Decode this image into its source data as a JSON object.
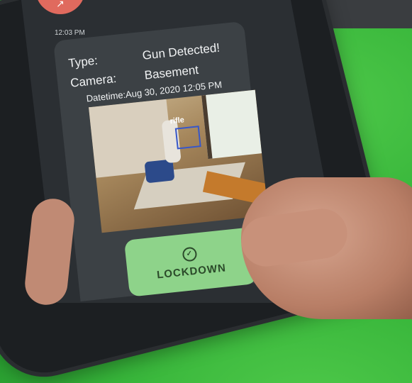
{
  "notification": {
    "time": "12:03 PM",
    "type_label": "Type:",
    "type_value": "Gun Detected!",
    "camera_label": "Camera:",
    "camera_value": "Basement",
    "datetime": "Datetime:Aug 30, 2020 12:05 PM",
    "detection_tag": "rifle",
    "action_label": "LOCKDOWN"
  },
  "colors": {
    "background": "#37b53a",
    "button": "#8ed38a",
    "alert": "#e06a5e"
  }
}
